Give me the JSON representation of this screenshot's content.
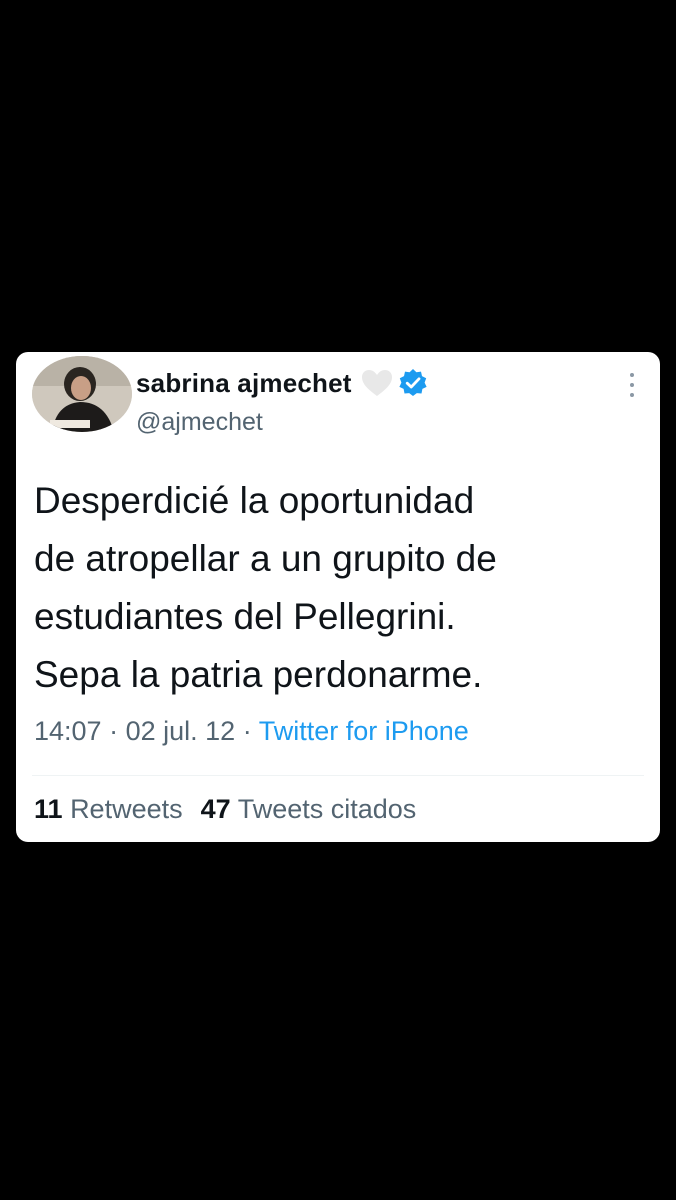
{
  "tweet": {
    "author": {
      "display_name": "sabrina ajmechet",
      "handle": "@ajmechet",
      "verified_color": "#1d9bf0",
      "heart_color": "#e8e8e8"
    },
    "text_lines": [
      "Desperdicié la oportunidad",
      "de atropellar a un grupito de",
      "estudiantes del Pellegrini.",
      "Sepa la patria perdonarme."
    ],
    "time": "14:07",
    "separator": "·",
    "date": "02 jul. 12",
    "source": "Twitter for iPhone",
    "stats": {
      "retweets_count": "11",
      "retweets_label": "Retweets",
      "quotes_count": "47",
      "quotes_label": "Tweets citados"
    }
  },
  "icons": [
    "heart-icon",
    "verified-icon",
    "more-icon"
  ]
}
